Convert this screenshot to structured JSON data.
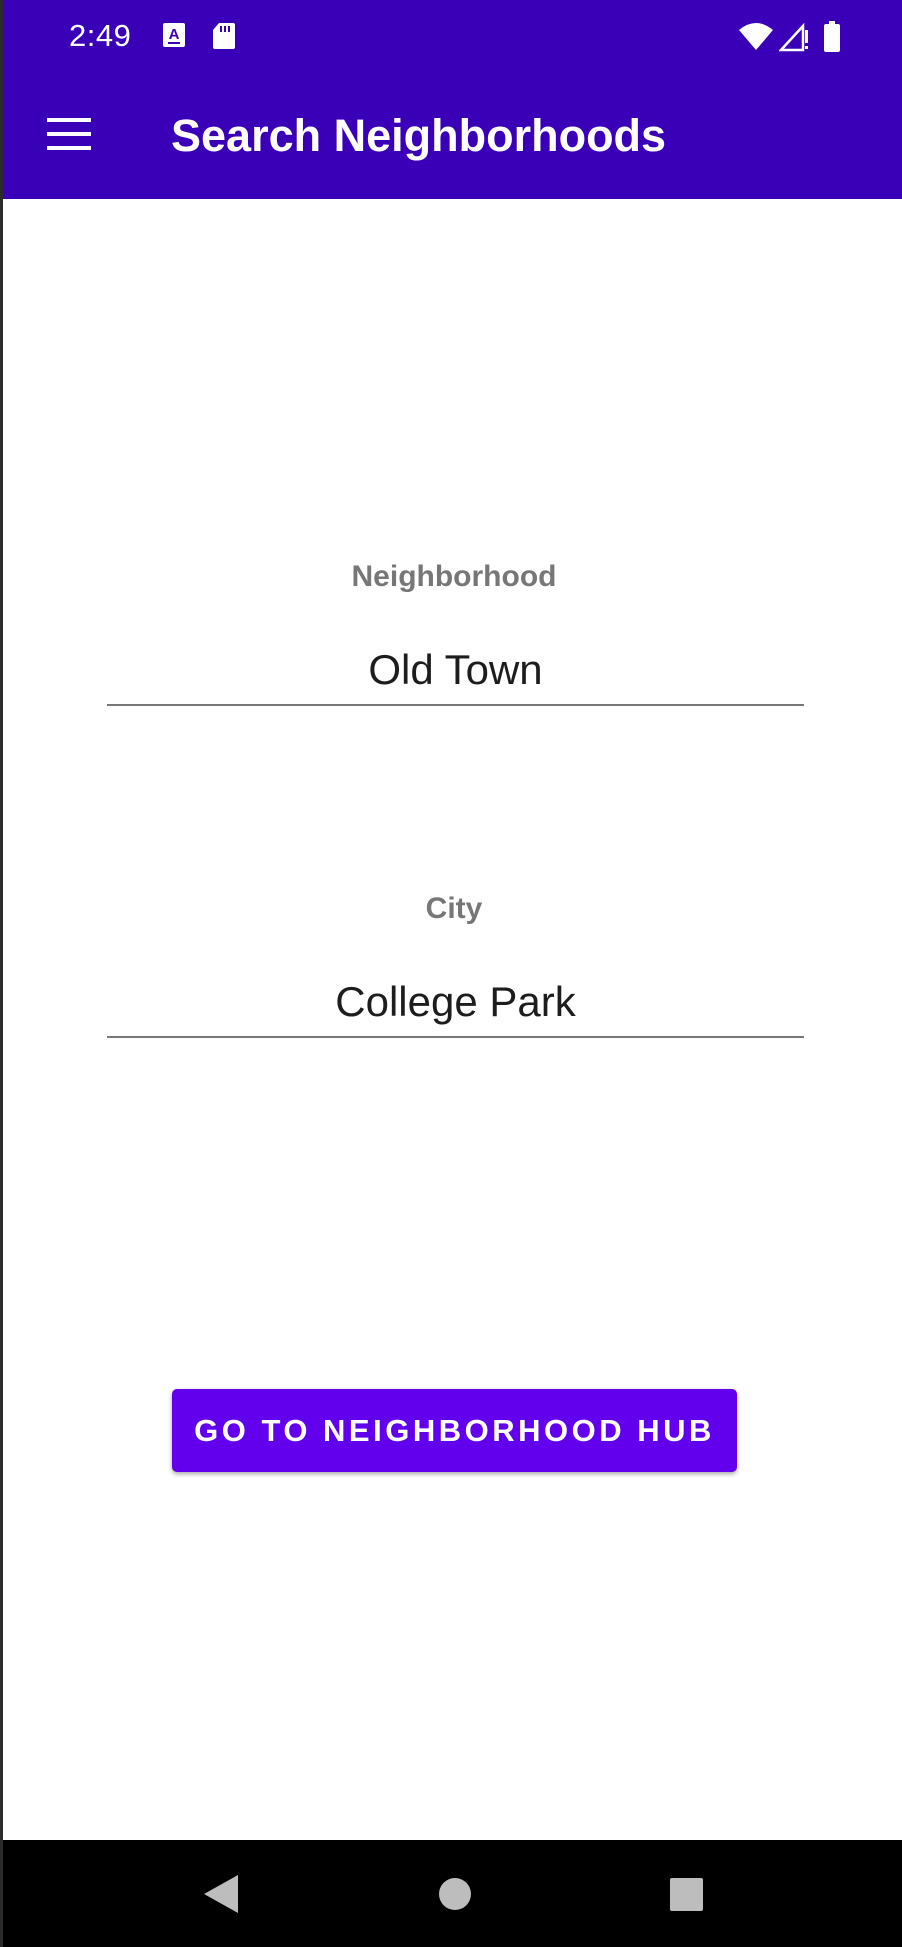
{
  "status_bar": {
    "time": "2:49",
    "icons": [
      "keyboard-a-icon",
      "sd-card-icon",
      "wifi-icon",
      "signal-icon",
      "battery-icon"
    ]
  },
  "app_bar": {
    "title": "Search Neighborhoods",
    "menu_icon": "hamburger-menu-icon",
    "color": "#3a00b8"
  },
  "form": {
    "neighborhood": {
      "label": "Neighborhood",
      "value": "Old Town"
    },
    "city": {
      "label": "City",
      "value": "College Park"
    },
    "submit": {
      "label": "GO TO NEIGHBORHOOD HUB",
      "color": "#6200ee"
    }
  },
  "nav_bar": {
    "buttons": [
      "back-icon",
      "home-icon",
      "recents-icon"
    ]
  }
}
